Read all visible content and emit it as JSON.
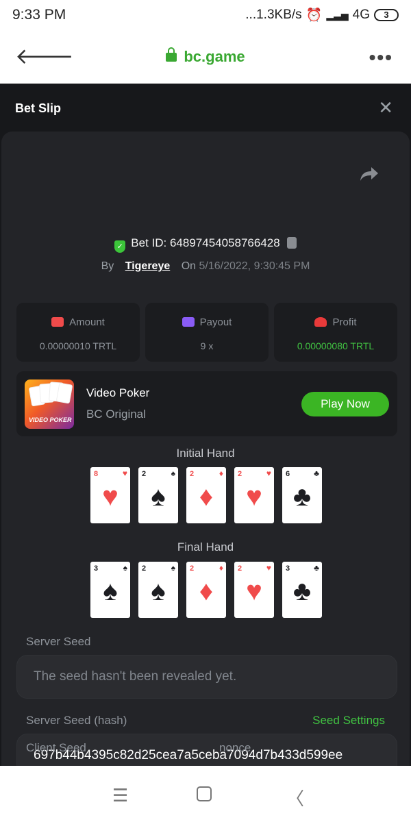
{
  "status": {
    "time": "9:33 PM",
    "network": "...1.3KB/s",
    "signal": "4G",
    "battery": "3"
  },
  "browser": {
    "url": "bc.game"
  },
  "panel": {
    "title": "Bet Slip"
  },
  "bet": {
    "id_label": "Bet ID: 64897454058766428",
    "by_label": "By",
    "user": "Tigereye",
    "on_label": "On",
    "date": "5/16/2022, 9:30:45 PM"
  },
  "stats": [
    {
      "label": "Amount",
      "value": "0.00000010 TRTL",
      "icon": "amount-icon",
      "color": "#f04b4b"
    },
    {
      "label": "Payout",
      "value": "9 x",
      "icon": "payout-icon",
      "color": "#8a5cf6"
    },
    {
      "label": "Profit",
      "value": "0.00000080 TRTL",
      "icon": "profit-icon",
      "color": "#e93a3a"
    }
  ],
  "game": {
    "name": "Video Poker",
    "provider": "BC Original",
    "play_label": "Play Now",
    "thumb_text": "VIDEO POKER"
  },
  "initial_hand": {
    "title": "Initial Hand",
    "cards": [
      {
        "rank": "8",
        "suit": "♥"
      },
      {
        "rank": "2",
        "suit": "♠"
      },
      {
        "rank": "2",
        "suit": "♦"
      },
      {
        "rank": "2",
        "suit": "♥"
      },
      {
        "rank": "6",
        "suit": "♣"
      }
    ]
  },
  "final_hand": {
    "title": "Final Hand",
    "cards": [
      {
        "rank": "3",
        "suit": "♠"
      },
      {
        "rank": "2",
        "suit": "♠"
      },
      {
        "rank": "2",
        "suit": "♦"
      },
      {
        "rank": "2",
        "suit": "♥"
      },
      {
        "rank": "3",
        "suit": "♣"
      }
    ]
  },
  "seeds": {
    "server_seed_label": "Server Seed",
    "server_seed_value": "The seed hasn't been revealed yet.",
    "server_hash_label": "Server Seed (hash)",
    "seed_settings": "Seed Settings",
    "server_hash_value": "697b44b4395c82d25cea7a5ceba7094d7b433d599ee",
    "client_seed_label": "Client Seed",
    "nonce_label": "nonce"
  }
}
